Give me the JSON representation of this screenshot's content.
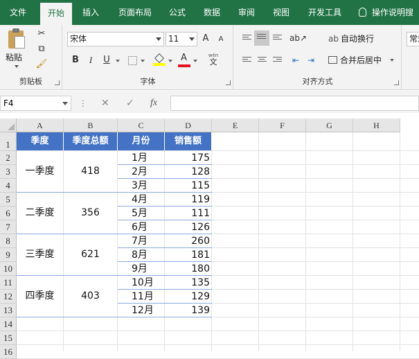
{
  "ribbon_tabs": {
    "file": "文件",
    "home": "开始",
    "insert": "插入",
    "page_layout": "页面布局",
    "formulas": "公式",
    "data": "数据",
    "review": "审阅",
    "view": "视图",
    "developer": "开发工具",
    "tell_me": "操作说明搜"
  },
  "clipboard": {
    "paste": "粘贴",
    "label": "剪贴板"
  },
  "font": {
    "name": "宋体",
    "size": "11",
    "grow": "A",
    "shrink": "A",
    "bold": "B",
    "italic": "I",
    "underline": "U",
    "font_color_letter": "A",
    "phonetic": "文",
    "phonetic_top": "wén",
    "label": "字体"
  },
  "alignment": {
    "wrap_text": "自动换行",
    "merge_center": "合并后居中",
    "label": "对齐方式"
  },
  "number": {
    "format": "常规"
  },
  "formula_bar": {
    "name_box": "F4",
    "cancel": "✕",
    "enter": "✓",
    "fx": "fx",
    "value": ""
  },
  "columns": [
    "A",
    "B",
    "C",
    "D",
    "E",
    "F",
    "G",
    "H"
  ],
  "rows": [
    "1",
    "2",
    "3",
    "4",
    "5",
    "6",
    "7",
    "8",
    "9",
    "10",
    "11",
    "12",
    "13",
    "14",
    "15",
    "16"
  ],
  "table": {
    "headers": [
      "季度",
      "季度总额",
      "月份",
      "销售额"
    ],
    "quarters": [
      {
        "name": "一季度",
        "total": "418",
        "months": [
          {
            "m": "1月",
            "v": "175"
          },
          {
            "m": "2月",
            "v": "128"
          },
          {
            "m": "3月",
            "v": "115"
          }
        ]
      },
      {
        "name": "二季度",
        "total": "356",
        "months": [
          {
            "m": "4月",
            "v": "119"
          },
          {
            "m": "5月",
            "v": "111"
          },
          {
            "m": "6月",
            "v": "126"
          }
        ]
      },
      {
        "name": "三季度",
        "total": "621",
        "months": [
          {
            "m": "7月",
            "v": "260"
          },
          {
            "m": "8月",
            "v": "181"
          },
          {
            "m": "9月",
            "v": "180"
          }
        ]
      },
      {
        "name": "四季度",
        "total": "403",
        "months": [
          {
            "m": "10月",
            "v": "135"
          },
          {
            "m": "11月",
            "v": "129"
          },
          {
            "m": "12月",
            "v": "139"
          }
        ]
      }
    ]
  },
  "colors": {
    "ribbon_green": "#217346",
    "header_blue": "#4472c4",
    "font_color_red": "#e81123",
    "highlight_yellow": "#ffff00"
  }
}
